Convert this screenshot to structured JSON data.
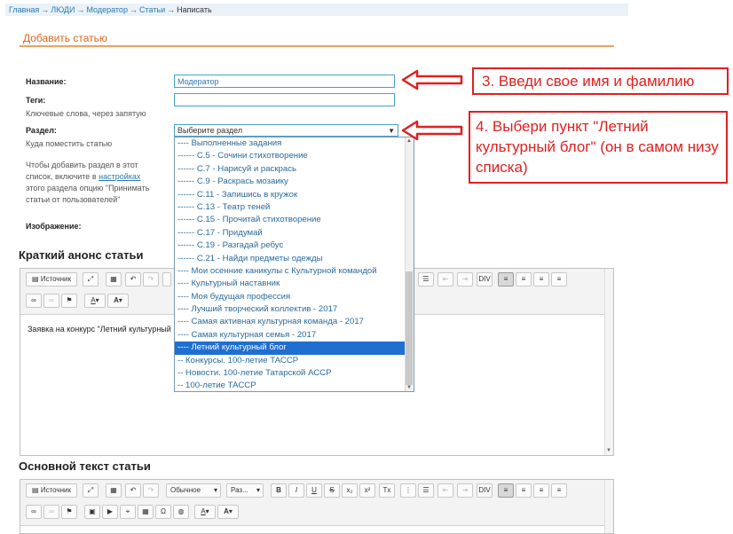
{
  "breadcrumb": {
    "items": [
      "Главная",
      "ЛЮДИ",
      "Модератор",
      "Статьи"
    ],
    "current": "Написать"
  },
  "page_title": "Добавить статью",
  "form": {
    "title_label": "Название:",
    "title_value": "Модератор",
    "tags_label": "Теги:",
    "tags_hint": "Ключевые слова, через запятую",
    "section_label": "Раздел:",
    "section_hint": "Куда поместить статью",
    "section_help_1": "Чтобы добавить раздел в этот",
    "section_help_2_pre": "список, включите в ",
    "section_help_2_link": "настройках",
    "section_help_3": "этого раздела опцию \"Принимать",
    "section_help_4": "статьи от пользователей\"",
    "select_value": "Выберите раздел",
    "image_label": "Изображение:"
  },
  "dropdown_items": [
    "---- Выполненные задания",
    "------ С.5 - Сочини стихотворение",
    "------ С.7 - Нарисуй и раскрась",
    "------ С.9 - Раскрась мозаику",
    "------ С.11 - Запишись в кружок",
    "------ С.13 - Театр теней",
    "------ С.15 - Прочитай стихотворение",
    "------ С.17 - Придумай",
    "------ С.19 - Разгадай ребус",
    "------ С.21 - Найди предметы одежды",
    "---- Мои осенние каникулы с Культурной командой",
    "---- Культурный наставник",
    "---- Моя будущая профессия",
    "---- Лучший творческий коллектив - 2017",
    "---- Самая активная культурная команда - 2017",
    "---- Самая культурная семья - 2017",
    "---- Летний культурный блог",
    "-- Конкурсы. 100-летие ТАССР",
    "-- Новости. 100-летие Татарской АССР",
    "-- 100-летие ТАССР"
  ],
  "dropdown_selected_index": 16,
  "callouts": {
    "step3": "3. Введи свое имя и фамилию",
    "step4": "4.  Выбери пункт \"Летний культурный блог\" (он в самом низу списка)"
  },
  "editor1": {
    "heading": "Краткий анонс статьи",
    "source_label": "Источник",
    "content": "Заявка на конкурс \"Летний культурный"
  },
  "editor2": {
    "heading": "Основной текст статьи",
    "source_label": "Источник",
    "format_label": "Обычное",
    "size_label": "Раз..."
  },
  "colors": {
    "accent": "#e0661b",
    "link": "#2a7ab0",
    "callout": "#e02020",
    "selected_item": "#1f6fd1"
  }
}
